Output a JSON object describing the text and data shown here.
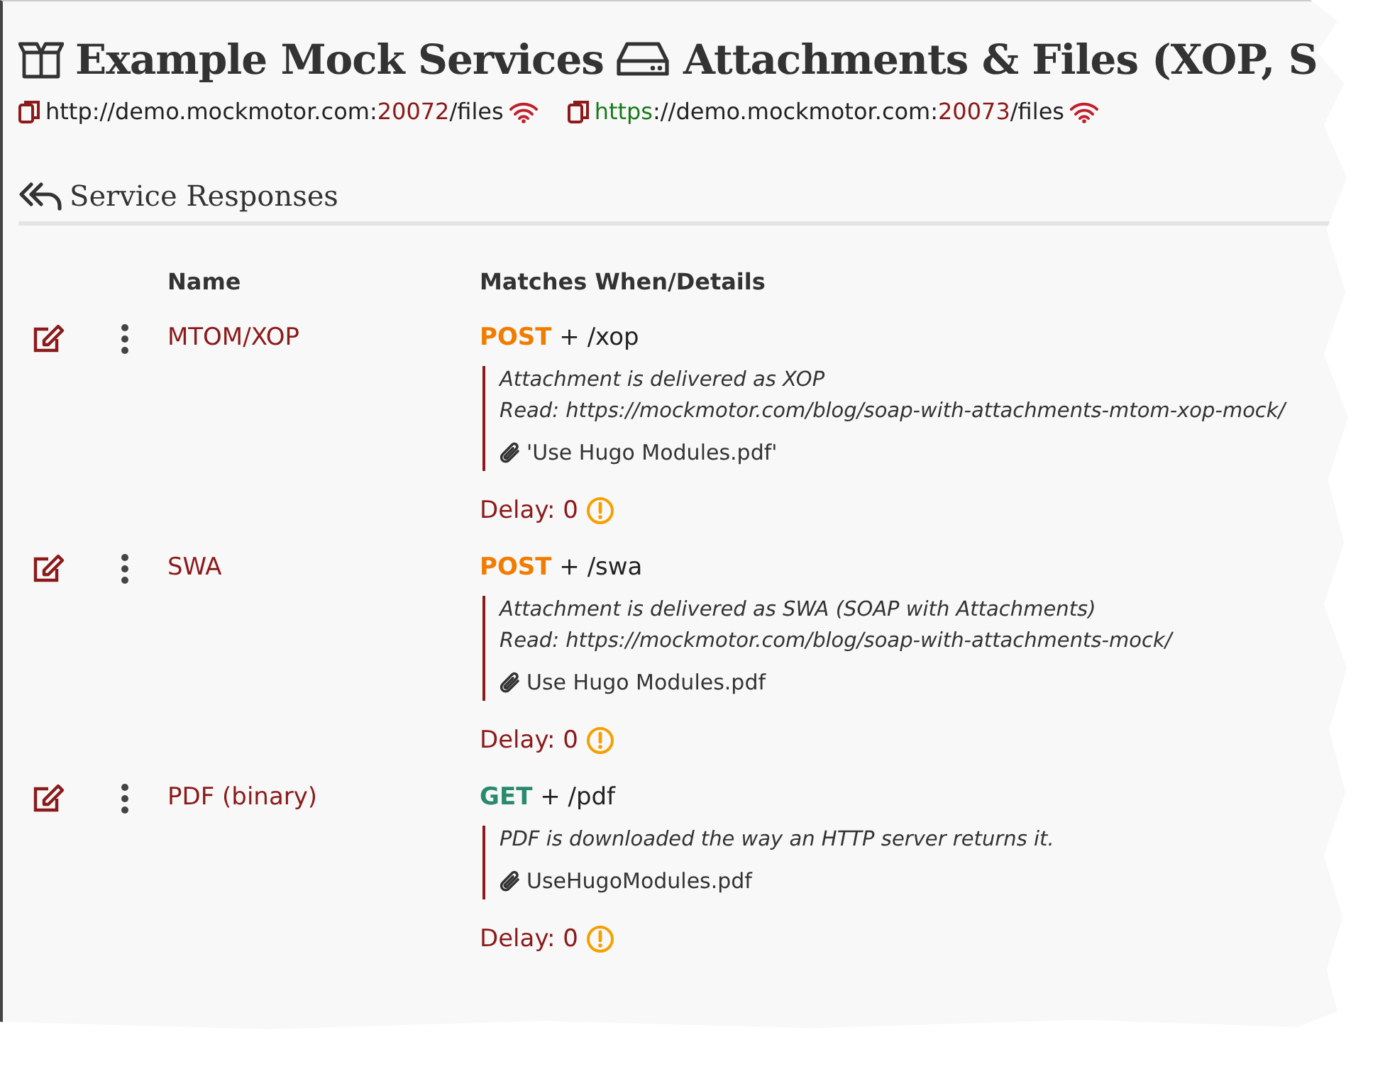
{
  "header": {
    "title": "Example Mock Services",
    "subtitle": "Attachments & Files (XOP, S"
  },
  "endpoints": [
    {
      "scheme": "http",
      "secure": false,
      "host": "://demo.mockmotor.com:",
      "port": "20072",
      "path": "/files"
    },
    {
      "scheme": "https",
      "secure": true,
      "host": "://demo.mockmotor.com:",
      "port": "20073",
      "path": "/files"
    }
  ],
  "section": {
    "title": "Service Responses"
  },
  "table": {
    "columns": [
      "Name",
      "Matches When/Details"
    ],
    "rows": [
      {
        "name": "MTOM/XOP",
        "method": "POST",
        "color": "#f07c00",
        "path": "+ /xop",
        "details": [
          "Attachment is delivered as XOP",
          "Read: https://mockmotor.com/blog/soap-with-attachments-mtom-xop-mock/"
        ],
        "attachment": "'Use Hugo Modules.pdf'",
        "delay": "Delay: 0"
      },
      {
        "name": "SWA",
        "method": "POST",
        "color": "#f07c00",
        "path": "+ /swa",
        "details": [
          "Attachment is delivered as SWA (SOAP with Attachments)",
          "Read: https://mockmotor.com/blog/soap-with-attachments-mock/"
        ],
        "attachment": "Use Hugo Modules.pdf",
        "delay": "Delay: 0"
      },
      {
        "name": "PDF (binary)",
        "method": "GET",
        "color": "#2a8a6e",
        "path": "+ /pdf",
        "details": [
          "PDF is downloaded the way an HTTP server returns it."
        ],
        "attachment": "UseHugoModules.pdf",
        "delay": "Delay: 0"
      }
    ]
  }
}
